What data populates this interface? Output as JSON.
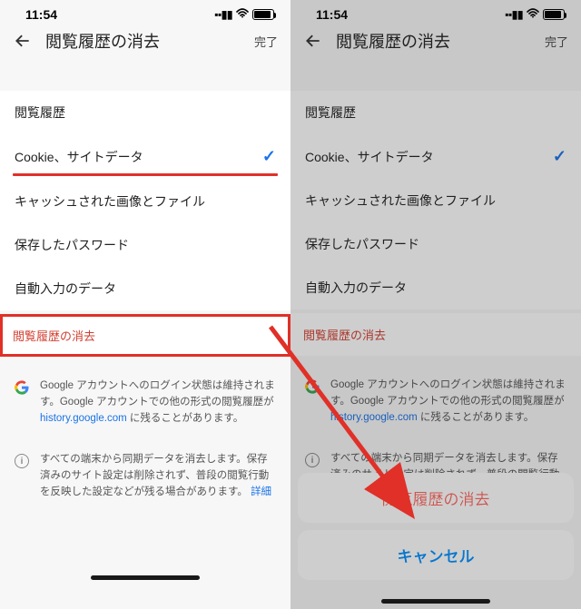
{
  "status": {
    "time": "11:54"
  },
  "nav": {
    "title": "閲覧履歴の消去",
    "done": "完了"
  },
  "options": {
    "history": "閲覧履歴",
    "cookies": "Cookie、サイトデータ",
    "cache": "キャッシュされた画像とファイル",
    "passwords": "保存したパスワード",
    "autofill": "自動入力のデータ"
  },
  "clear_action": "閲覧履歴の消去",
  "info1": {
    "text_a": "Google アカウントへのログイン状態は維持されます。Google アカウントでの他の形式の閲覧履歴が ",
    "link": "history.google.com",
    "text_b": " に残ることがあります。"
  },
  "info2": {
    "text": "すべての端末から同期データを消去します。保存済みのサイト設定は削除されず、普段の閲覧行動を反映した設定などが残る場合があります。",
    "link": "詳細"
  },
  "sheet": {
    "clear": "閲覧履歴の消去",
    "cancel": "キャンセル"
  }
}
